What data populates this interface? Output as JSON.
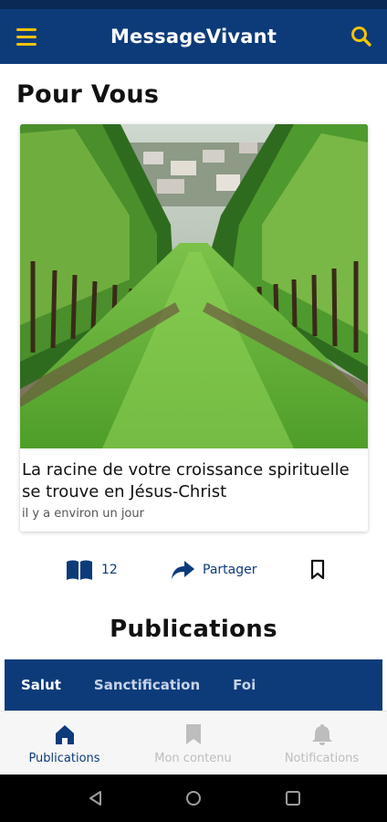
{
  "app": {
    "title": "MessageVivant"
  },
  "header": {
    "menu_icon": "menu-icon",
    "search_icon": "search-icon"
  },
  "for_you": {
    "title": "Pour Vous",
    "card": {
      "image_description_icon": "vineyard-photo",
      "title": "La racine de votre croissance spirituelle se trouve en Jésus-Christ",
      "time": "il y a environ un jour"
    }
  },
  "actions": {
    "reads_count": "12",
    "share_label": "Partager",
    "reads_icon": "open-book-icon",
    "share_icon": "share-arrow-icon",
    "save_icon": "bookmark-icon"
  },
  "publications": {
    "title": "Publications",
    "tabs": [
      {
        "label": "Salut",
        "active": true
      },
      {
        "label": "Sanctification",
        "active": false
      },
      {
        "label": "Foi",
        "active": false
      }
    ]
  },
  "bottom_nav": [
    {
      "label": "Publications",
      "icon": "home-icon",
      "active": true
    },
    {
      "label": "Mon contenu",
      "icon": "bookmark-icon",
      "active": false
    },
    {
      "label": "Notifications",
      "icon": "bell-icon",
      "active": false
    }
  ],
  "colors": {
    "primary": "#0d3b7a",
    "accent": "#f2c400",
    "inactive": "#bdbdbd"
  }
}
